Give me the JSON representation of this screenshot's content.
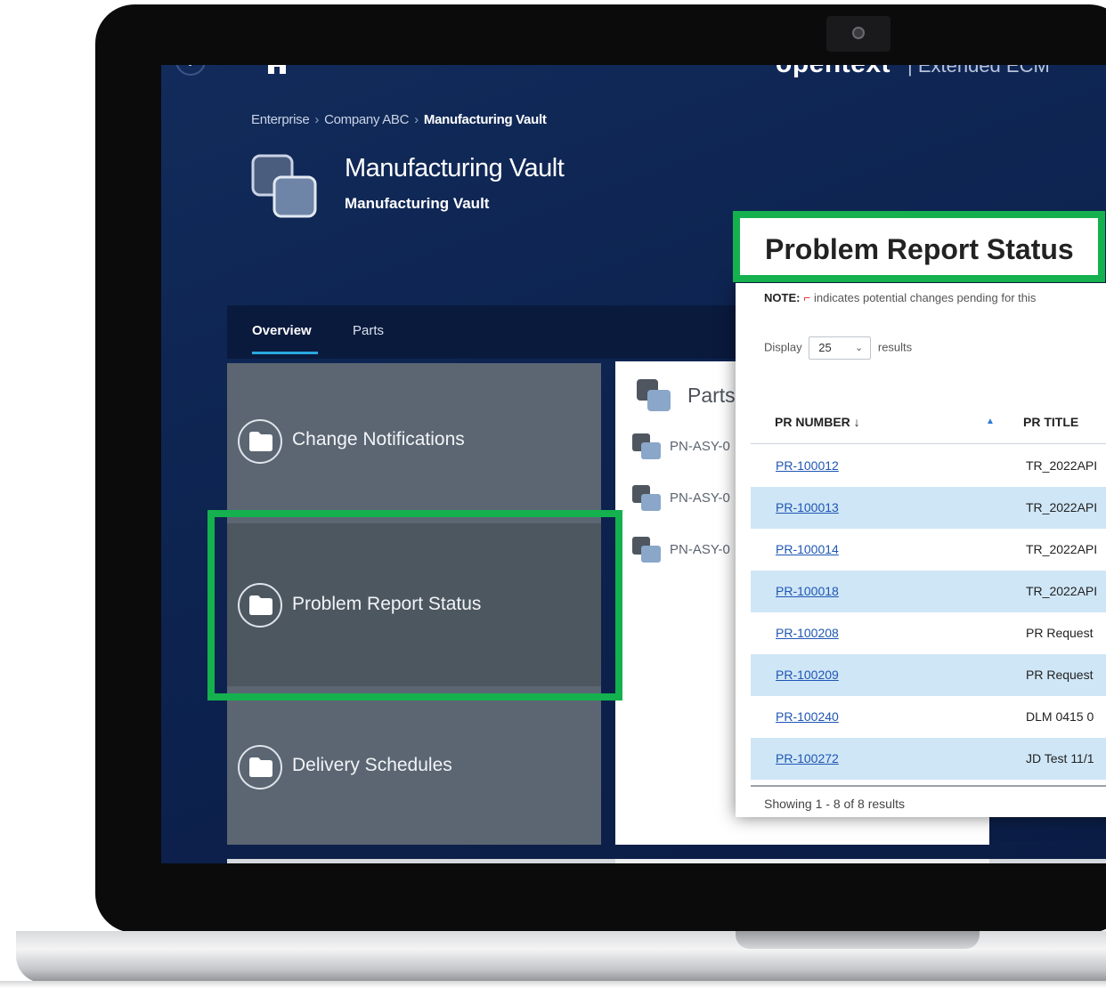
{
  "topbar": {
    "help_label": "?",
    "brand": "opentext",
    "brand_sub": "| Extended ECM"
  },
  "breadcrumb": {
    "items": [
      "Enterprise",
      "Company ABC",
      "Manufacturing Vault"
    ],
    "separator": "›"
  },
  "header": {
    "title": "Manufacturing Vault",
    "subtitle": "Manufacturing Vault"
  },
  "tabs": [
    {
      "label": "Overview",
      "active": true
    },
    {
      "label": "Parts",
      "active": false
    }
  ],
  "tiles": [
    {
      "label": "Change Notifications"
    },
    {
      "label": "Problem Report Status"
    },
    {
      "label": "Delivery Schedules"
    }
  ],
  "parts_panel": {
    "title": "Parts",
    "items": [
      "PN-ASY-0",
      "PN-ASY-0",
      "PN-ASY-0"
    ]
  },
  "problem_report": {
    "heading": "Problem Report Status",
    "note_label": "NOTE:",
    "note_text": "indicates potential changes pending for this",
    "display_label": "Display",
    "display_value": "25",
    "results_label": "results",
    "columns": {
      "pr_number": "PR NUMBER ↓",
      "sort_indicator": "▲",
      "pr_title": "PR TITLE"
    },
    "rows": [
      {
        "number": "PR-100012",
        "title": "TR_2022API"
      },
      {
        "number": "PR-100013",
        "title": "TR_2022API"
      },
      {
        "number": "PR-100014",
        "title": "TR_2022API"
      },
      {
        "number": "PR-100018",
        "title": "TR_2022API"
      },
      {
        "number": "PR-100208",
        "title": "PR Request"
      },
      {
        "number": "PR-100209",
        "title": "PR Request"
      },
      {
        "number": "PR-100240",
        "title": "DLM 0415 0"
      },
      {
        "number": "PR-100272",
        "title": "JD Test 11/1"
      }
    ],
    "showing": "Showing 1 - 8 of 8 results"
  },
  "colors": {
    "highlight": "#14b14e",
    "screen_bg": "#0d2350",
    "link": "#1f56b5",
    "row_alt": "#cfe6f6"
  },
  "icons": [
    "help-icon",
    "home-icon",
    "chevron-up-icon",
    "vault-icon",
    "folder-icon",
    "parts-icon",
    "camera-icon",
    "chevron-down-icon"
  ]
}
